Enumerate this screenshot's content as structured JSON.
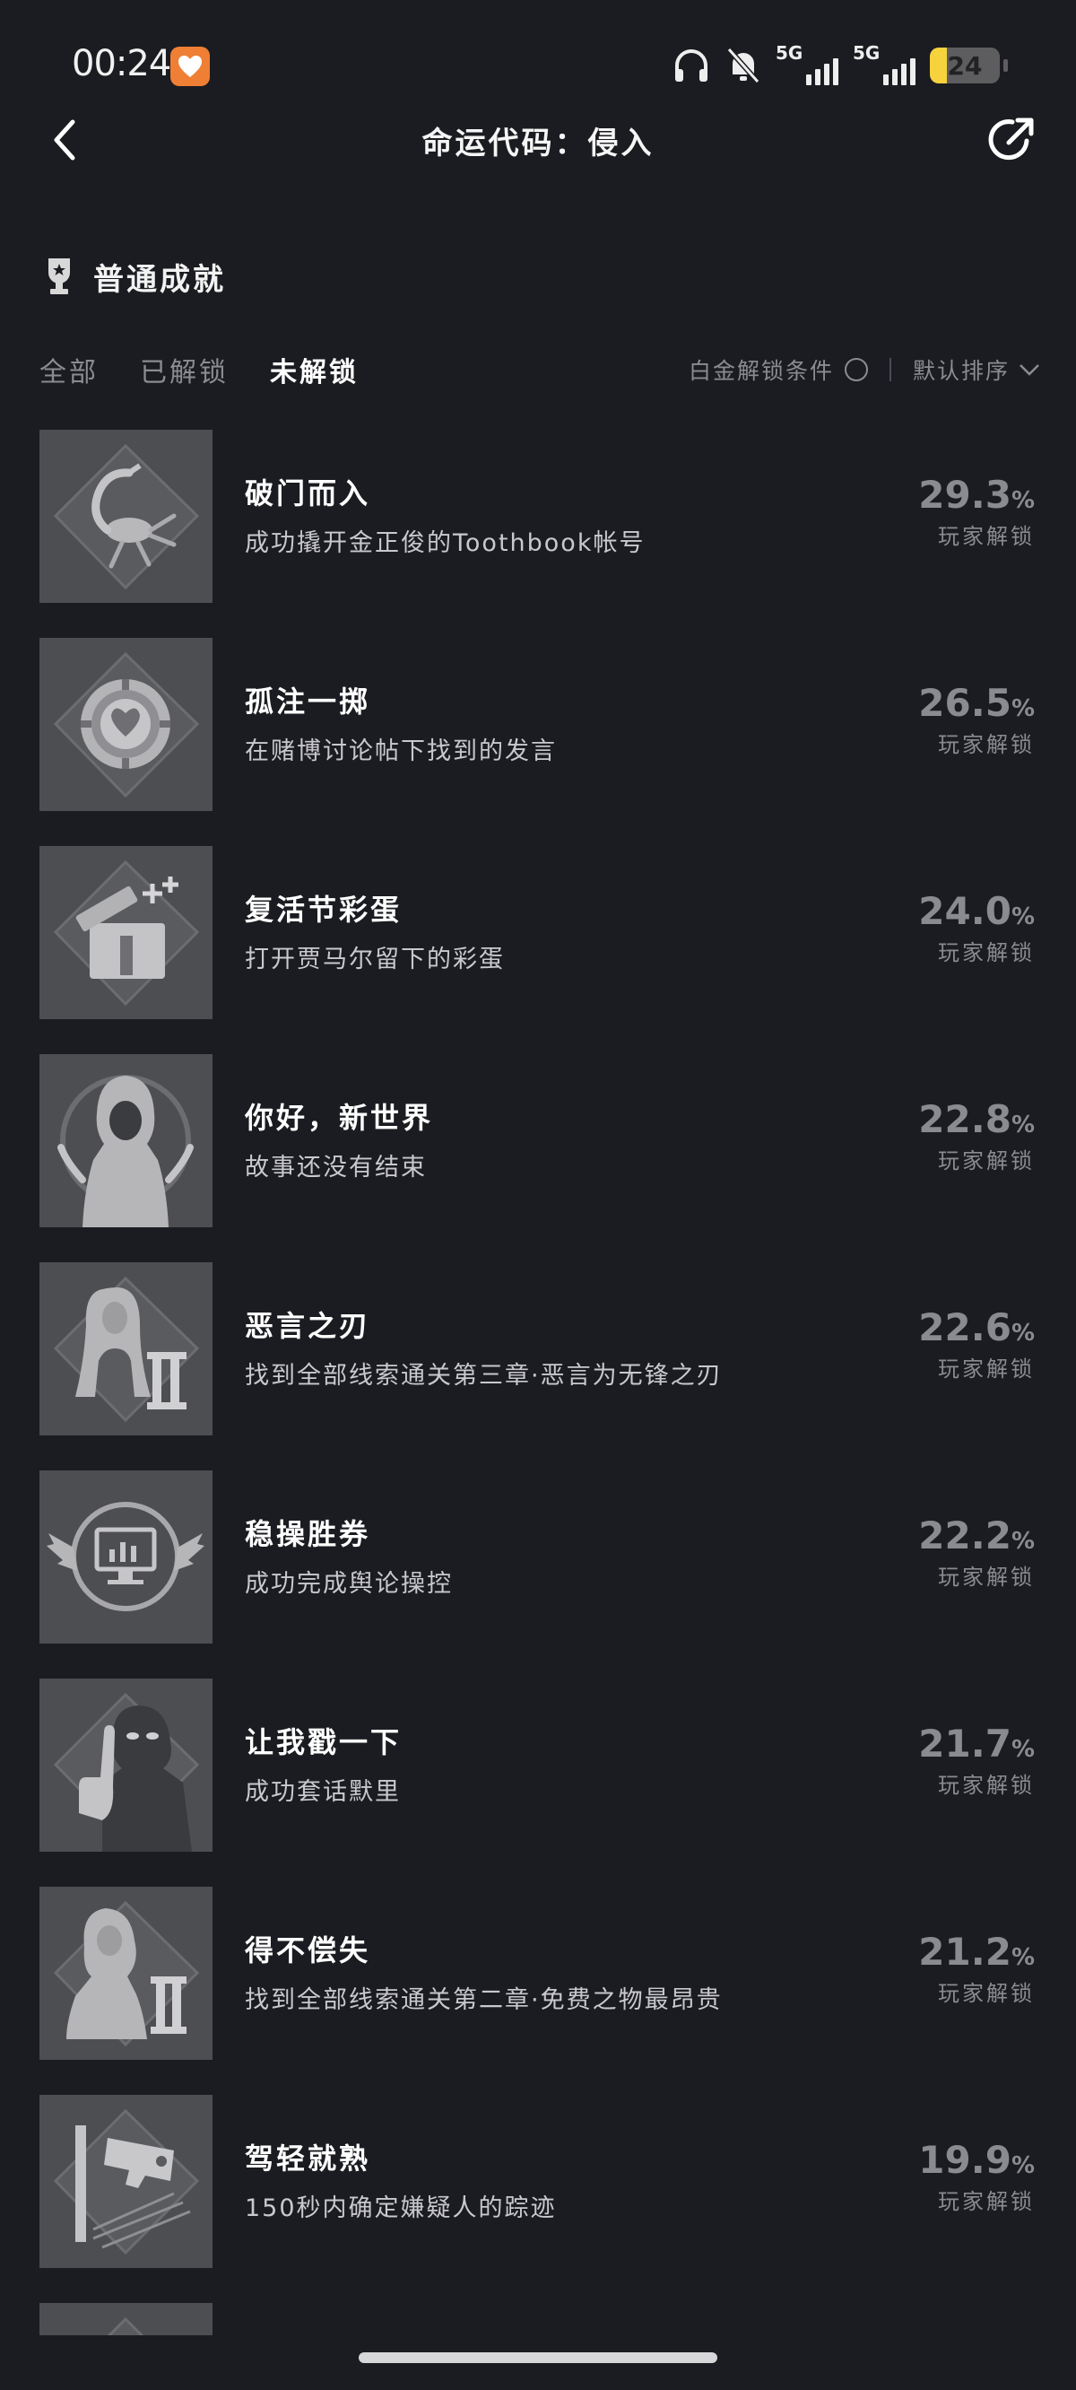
{
  "status_bar": {
    "time": "00:24",
    "network_1": "5G",
    "network_2": "5G",
    "battery_level": "24"
  },
  "header": {
    "title": "命运代码：侵入"
  },
  "section": {
    "title": "普通成就"
  },
  "filters": {
    "tabs": [
      "全部",
      "已解锁",
      "未解锁"
    ],
    "active_tab": "未解锁",
    "platinum_label": "白金解锁条件",
    "sort_label": "默认排序"
  },
  "achievements": [
    {
      "name": "破门而入",
      "desc": "成功撬开金正俊的Toothbook帐号",
      "rate": "29.3",
      "unit": "%",
      "rate_label": "玩家解锁",
      "icon": "scorpion-icon"
    },
    {
      "name": "孤注一掷",
      "desc": "在赌博讨论帖下找到的发言",
      "rate": "26.5",
      "unit": "%",
      "rate_label": "玩家解锁",
      "icon": "casino-chip-icon"
    },
    {
      "name": "复活节彩蛋",
      "desc": "打开贾马尔留下的彩蛋",
      "rate": "24.0",
      "unit": "%",
      "rate_label": "玩家解锁",
      "icon": "gift-box-icon"
    },
    {
      "name": "你好，新世界",
      "desc": "故事还没有结束",
      "rate": "22.8",
      "unit": "%",
      "rate_label": "玩家解锁",
      "icon": "hooded-figure-icon"
    },
    {
      "name": "恶言之刃",
      "desc": "找到全部线索通关第三章·恶言为无锋之刃",
      "rate": "22.6",
      "unit": "%",
      "rate_label": "玩家解锁",
      "icon": "chapter-three-woman-icon"
    },
    {
      "name": "稳操胜券",
      "desc": "成功完成舆论操控",
      "rate": "22.2",
      "unit": "%",
      "rate_label": "玩家解锁",
      "icon": "winged-monitor-icon"
    },
    {
      "name": "让我戳一下",
      "desc": "成功套话默里",
      "rate": "21.7",
      "unit": "%",
      "rate_label": "玩家解锁",
      "icon": "masked-man-pointing-icon"
    },
    {
      "name": "得不偿失",
      "desc": "找到全部线索通关第二章·免费之物最昂贵",
      "rate": "21.2",
      "unit": "%",
      "rate_label": "玩家解锁",
      "icon": "chapter-two-woman-icon"
    },
    {
      "name": "驾轻就熟",
      "desc": "150秒内确定嫌疑人的踪迹",
      "rate": "19.9",
      "unit": "%",
      "rate_label": "玩家解锁",
      "icon": "surveillance-camera-icon"
    }
  ]
}
